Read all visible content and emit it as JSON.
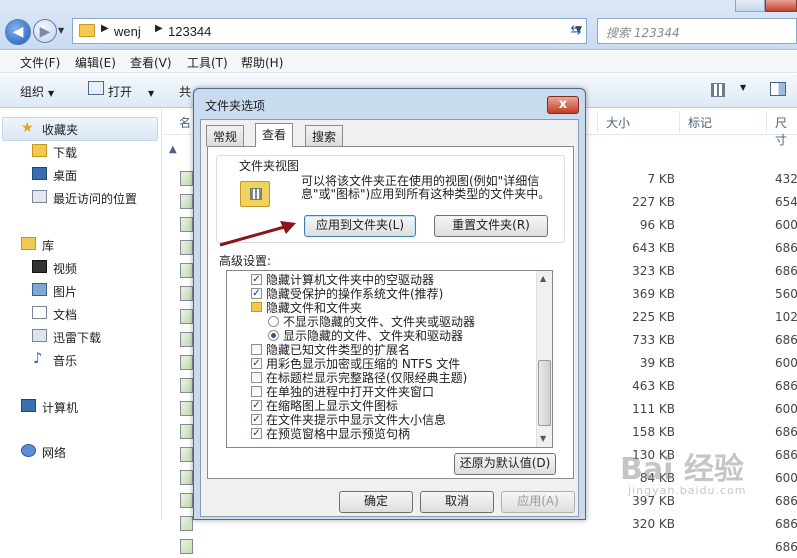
{
  "address": {
    "crumbs": [
      "wenj",
      "123344"
    ]
  },
  "search": {
    "placeholder": "搜索 123344"
  },
  "menubar": [
    "文件(F)",
    "编辑(E)",
    "查看(V)",
    "工具(T)",
    "帮助(H)"
  ],
  "toolbar": {
    "organize": "组织",
    "open": "打开",
    "share_partial": "共"
  },
  "sidebar": {
    "favorites": "收藏夹",
    "fav_items": [
      "下载",
      "桌面",
      "最近访问的位置"
    ],
    "libraries": "库",
    "lib_items": [
      "视频",
      "图片",
      "文档",
      "迅雷下载",
      "音乐"
    ],
    "computer": "计算机",
    "network": "网络"
  },
  "columns": {
    "name_partial": "名",
    "size": "大小",
    "tags": "标记",
    "dims_partial": "尺寸"
  },
  "files": [
    {
      "size": "7 KB",
      "dim": "432"
    },
    {
      "size": "227 KB",
      "dim": "654"
    },
    {
      "size": "96 KB",
      "dim": "600"
    },
    {
      "size": "643 KB",
      "dim": "686"
    },
    {
      "size": "323 KB",
      "dim": "686"
    },
    {
      "size": "369 KB",
      "dim": "560"
    },
    {
      "size": "225 KB",
      "dim": "102"
    },
    {
      "size": "733 KB",
      "dim": "686"
    },
    {
      "size": "39 KB",
      "dim": "600"
    },
    {
      "size": "463 KB",
      "dim": "686"
    },
    {
      "size": "111 KB",
      "dim": "600"
    },
    {
      "size": "158 KB",
      "dim": "686"
    },
    {
      "size": "130 KB",
      "dim": "686"
    },
    {
      "size": "84 KB",
      "dim": "600"
    },
    {
      "size": "397 KB",
      "dim": "686"
    },
    {
      "size": "320 KB",
      "dim": "686"
    },
    {
      "size": "",
      "dim": "686"
    }
  ],
  "dialog": {
    "title": "文件夹选项",
    "close": "x",
    "tabs": [
      "常规",
      "查看",
      "搜索"
    ],
    "folder_views_label": "文件夹视图",
    "folder_views_desc": "可以将该文件夹正在使用的视图(例如\"详细信息\"或\"图标\")应用到所有这种类型的文件夹中。",
    "apply_to_folders": "应用到文件夹(L)",
    "reset_folders": "重置文件夹(R)",
    "advanced_label": "高级设置:",
    "advanced_items": [
      {
        "type": "check",
        "checked": true,
        "indent": 1,
        "label": "隐藏计算机文件夹中的空驱动器"
      },
      {
        "type": "check",
        "checked": true,
        "indent": 1,
        "label": "隐藏受保护的操作系统文件(推荐)"
      },
      {
        "type": "folder",
        "indent": 1,
        "label": "隐藏文件和文件夹"
      },
      {
        "type": "radio",
        "checked": false,
        "indent": 2,
        "label": "不显示隐藏的文件、文件夹或驱动器"
      },
      {
        "type": "radio",
        "checked": true,
        "indent": 2,
        "label": "显示隐藏的文件、文件夹和驱动器"
      },
      {
        "type": "check",
        "checked": false,
        "indent": 1,
        "label": "隐藏已知文件类型的扩展名"
      },
      {
        "type": "check",
        "checked": true,
        "indent": 1,
        "label": "用彩色显示加密或压缩的 NTFS 文件"
      },
      {
        "type": "check",
        "checked": false,
        "indent": 1,
        "label": "在标题栏显示完整路径(仅限经典主题)"
      },
      {
        "type": "check",
        "checked": false,
        "indent": 1,
        "label": "在单独的进程中打开文件夹窗口"
      },
      {
        "type": "check",
        "checked": true,
        "indent": 1,
        "label": "在缩略图上显示文件图标"
      },
      {
        "type": "check",
        "checked": true,
        "indent": 1,
        "label": "在文件夹提示中显示文件大小信息"
      },
      {
        "type": "check",
        "checked": true,
        "indent": 1,
        "label": "在预览窗格中显示预览句柄"
      }
    ],
    "restore_defaults": "还原为默认值(D)",
    "ok": "确定",
    "cancel": "取消",
    "apply": "应用(A)"
  },
  "watermark": {
    "line1": "Bai 经验",
    "line2": "jingyan.baidu.com"
  }
}
